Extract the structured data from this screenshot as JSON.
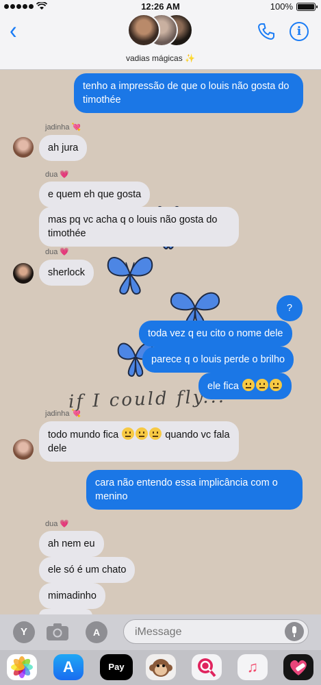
{
  "status_bar": {
    "time": "12:26 AM",
    "battery": "100%",
    "battery_level": 1.0
  },
  "header": {
    "group_name": "vadias mágicas ✨",
    "icons": [
      "back-chevron-icon",
      "phone-icon",
      "info-icon"
    ]
  },
  "messages": [
    {
      "type": "sent",
      "text": "tenho a impressão de que o louis não gosta do timothée"
    },
    {
      "sender": "jadinha 💘",
      "type": "received",
      "text": "ah jura"
    },
    {
      "sender": "dua 💗",
      "type": "received",
      "text": "e quem eh que gosta"
    },
    {
      "type": "received",
      "text": "mas pq vc acha q o louis não gosta do timothée"
    },
    {
      "sender": "dua 💗",
      "type": "received",
      "text": "sherlock"
    },
    {
      "type": "sent",
      "text": "?"
    },
    {
      "type": "sent",
      "text": "toda vez q eu cito o nome dele"
    },
    {
      "type": "sent",
      "text": "parece q o louis perde o brilho"
    },
    {
      "type": "sent",
      "text": "ele fica"
    },
    {
      "sender": "jadinha 💘",
      "type": "received",
      "text": "todo mundo fica",
      "text_after": "quando vc fala dele"
    },
    {
      "type": "sent",
      "text": "cara não entendo essa implicância com o menino"
    },
    {
      "sender": "dua 💗",
      "type": "received",
      "text": "ah nem eu"
    },
    {
      "type": "received",
      "text": "ele só é um chato"
    },
    {
      "type": "received",
      "text": "mimadinho"
    }
  ],
  "overlay_text": "if I could fly...",
  "input_bar": {
    "placeholder": "iMessage",
    "left_button": "Y"
  },
  "app_strip": {
    "pay_label": " Pay",
    "store_glyph": "A",
    "music_glyph": "♫",
    "icons": [
      "photos-icon",
      "app-store-icon",
      "apple-pay-icon",
      "animoji-icon",
      "search-images-icon",
      "music-icon",
      "heart-icon"
    ]
  },
  "colors": {
    "sent_bubble": "#1b77e6",
    "received_bubble": "#e7e6eb",
    "background": "#d6c9bb",
    "accent": "#1a7cf5"
  }
}
